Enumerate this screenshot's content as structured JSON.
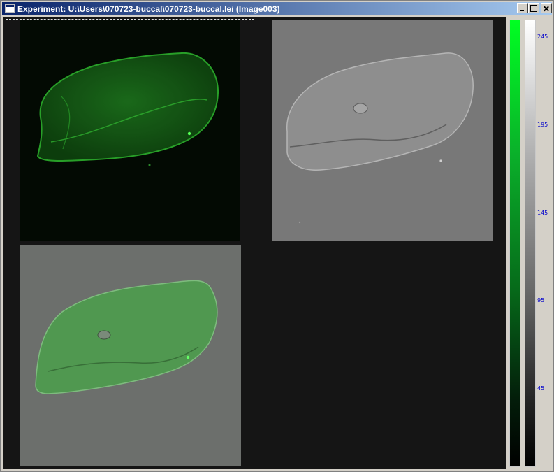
{
  "window": {
    "title": "Experiment: U:\\Users\\070723-buccal\\070723-buccal.lei  (Image003)",
    "buttons": {
      "minimize": "minimize",
      "maximize": "maximize",
      "close": "close"
    }
  },
  "images": [
    {
      "name": "green-channel",
      "color": "#1fa01f"
    },
    {
      "name": "dic-channel",
      "color": "#8c8c8c"
    },
    {
      "name": "overlay",
      "color": "#4e9c4e"
    }
  ],
  "colorbars": {
    "green": {
      "top_color": "#00ff22",
      "bottom_color": "#000000"
    },
    "gray": {
      "top_color": "#ffffff",
      "bottom_color": "#000000"
    },
    "ticks": [
      "245",
      "195",
      "145",
      "95",
      "45"
    ]
  }
}
